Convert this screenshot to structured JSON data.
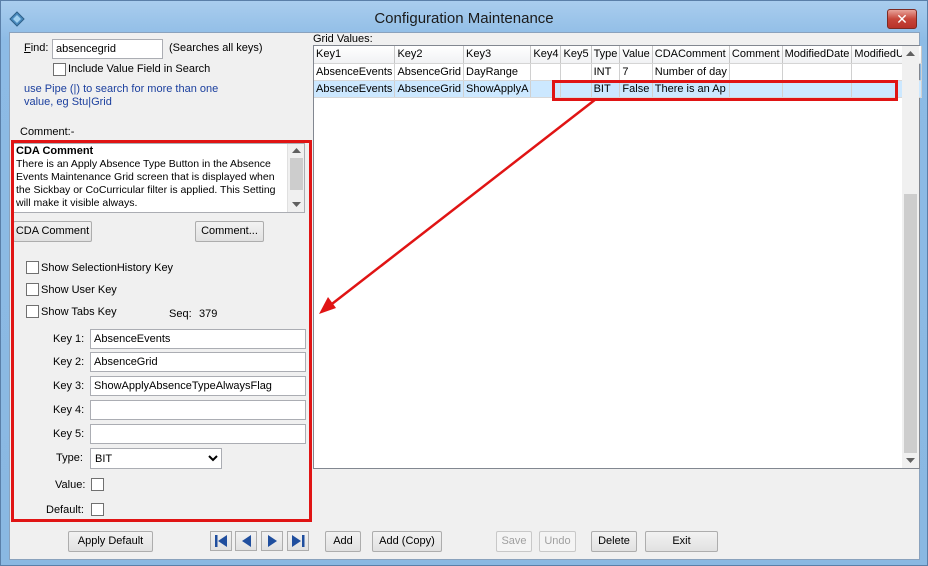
{
  "window": {
    "title": "Configuration Maintenance",
    "close_glyph": "✕"
  },
  "find": {
    "label_f": "F",
    "label_rest": "ind:",
    "value": "absencegrid",
    "hint": "(Searches all keys)",
    "include_value_label": "Include Value Field  in Search",
    "pipe_hint_line1": "use Pipe (|) to search for more than one",
    "pipe_hint_line2": "value, eg Stu|Grid"
  },
  "comment": {
    "label": "Comment:-",
    "title": "CDA Comment",
    "text": "There is an Apply Absence Type Button in the Absence Events Maintenance Grid screen that is displayed when the Sickbay or CoCurricular filter is applied. This Setting will make it visible always.",
    "cda_button": "CDA Comment",
    "comment_button": "Comment..."
  },
  "options": {
    "show_selection_history": "Show SelectionHistory Key",
    "show_user_key": "Show User Key",
    "show_tabs_key": "Show Tabs Key",
    "seq_label": "Seq:",
    "seq_value": "379"
  },
  "keys": {
    "key1_label": "Key 1:",
    "key1_value": "AbsenceEvents",
    "key2_label": "Key 2:",
    "key2_value": "AbsenceGrid",
    "key3_label": "Key 3:",
    "key3_value": "ShowApplyAbsenceTypeAlwaysFlag",
    "key4_label": "Key 4:",
    "key4_value": "",
    "key5_label": "Key 5:",
    "key5_value": "",
    "type_label": "Type:",
    "type_value": "BIT",
    "value_label": "Value:",
    "default_label": "Default:"
  },
  "grid": {
    "label": "Grid Values:",
    "columns": [
      "Key1",
      "Key2",
      "Key3",
      "Key4",
      "Key5",
      "Type",
      "Value",
      "CDAComment",
      "Comment",
      "ModifiedDate",
      "ModifiedUser"
    ],
    "rows": [
      [
        "AbsenceEvents",
        "AbsenceGrid",
        "DayRange",
        "",
        "",
        "INT",
        "7",
        "Number of day",
        "",
        "",
        ""
      ],
      [
        "AbsenceEvents",
        "AbsenceGrid",
        "ShowApplyA",
        "",
        "",
        "BIT",
        "False",
        "There is an Ap",
        "",
        "",
        ""
      ]
    ],
    "selected_row": 1
  },
  "footer": {
    "apply_default": "Apply Default",
    "add": "Add",
    "add_copy": "Add (Copy)",
    "save": "Save",
    "undo": "Undo",
    "delete": "Delete",
    "exit": "Exit"
  },
  "icons": {
    "app": "app-icon",
    "nav": [
      "first-record-icon",
      "previous-record-icon",
      "next-record-icon",
      "last-record-icon"
    ]
  },
  "colors": {
    "highlight": "#e01414",
    "selected_row": "#cce8ff"
  }
}
